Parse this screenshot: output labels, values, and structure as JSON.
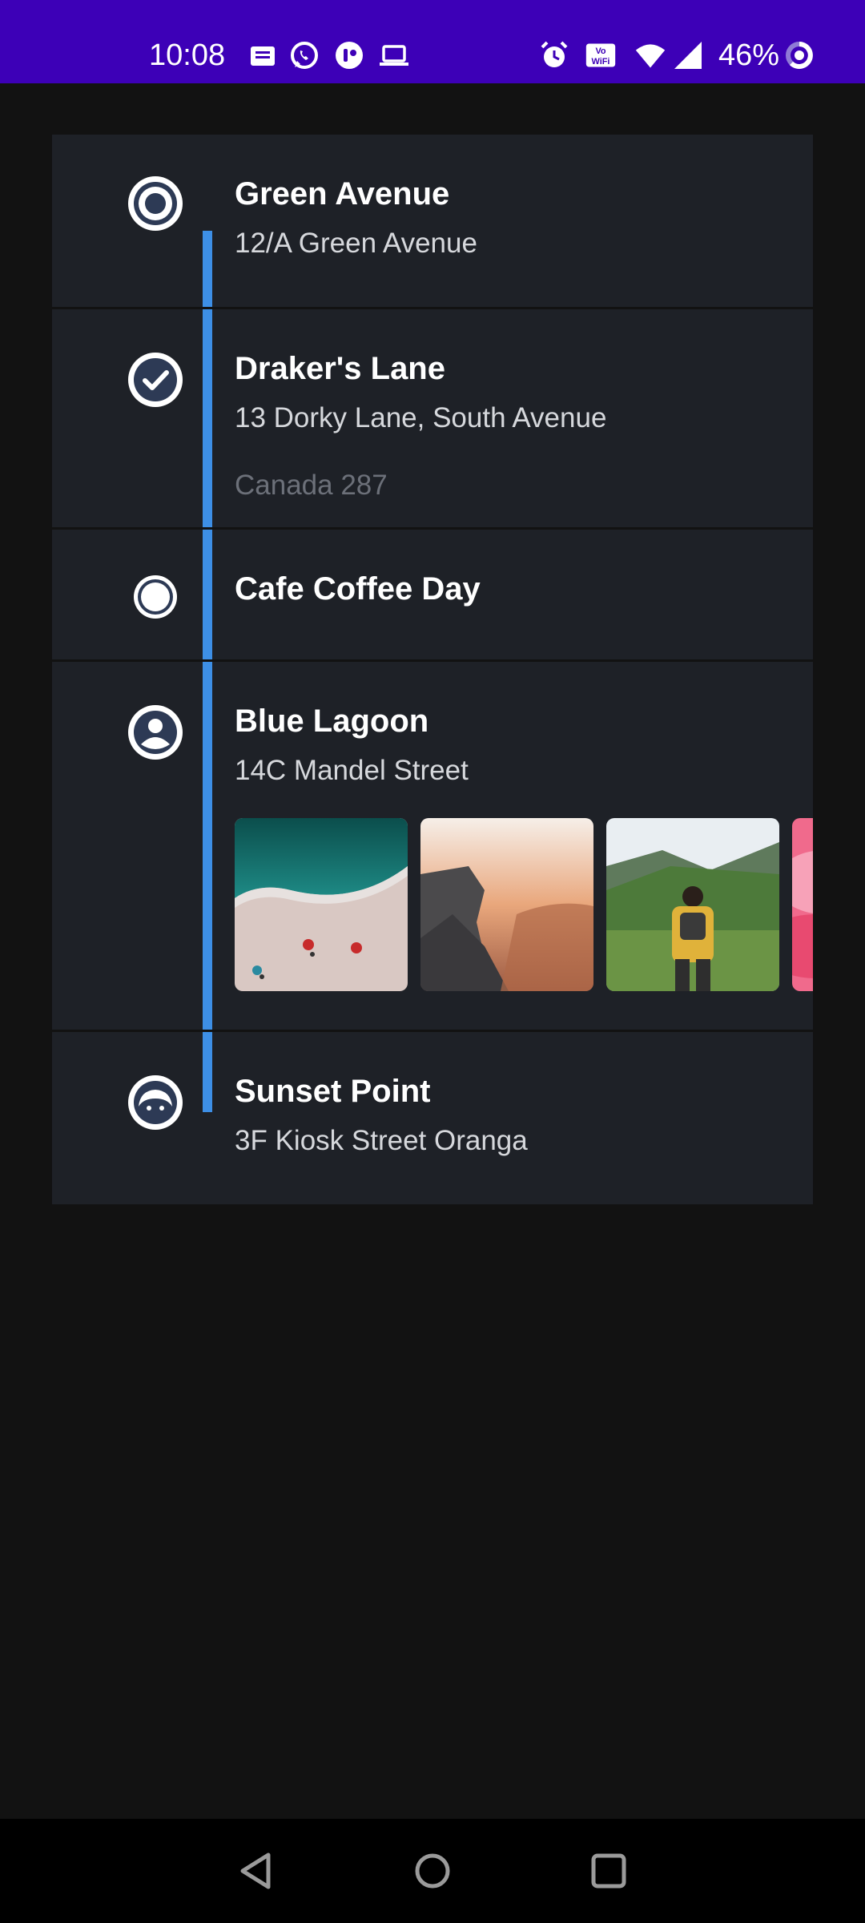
{
  "status_bar": {
    "time": "10:08",
    "battery_percent": "46%",
    "left_icons": [
      "message-icon",
      "whatsapp-icon",
      "app-icon",
      "laptop-icon"
    ],
    "right_icons": [
      "alarm-icon",
      "vowifi-icon",
      "wifi-icon",
      "signal-icon",
      "battery-ring-icon"
    ]
  },
  "timeline": {
    "accent_color": "#3d8fe6",
    "items": [
      {
        "title": "Green Avenue",
        "subtitle": "12/A Green Avenue",
        "marker_icon": "radio-target-icon"
      },
      {
        "title": "Draker's Lane",
        "subtitle": "13 Dorky Lane, South Avenue",
        "tertiary": "Canada 287",
        "marker_icon": "check-circle-icon"
      },
      {
        "title": "Cafe Coffee Day",
        "marker_icon": "dot-circle-icon"
      },
      {
        "title": "Blue Lagoon",
        "subtitle": "14C Mandel Street",
        "marker_icon": "account-circle-icon",
        "photos": [
          "beach-aerial-photo",
          "canyon-sunset-photo",
          "hiker-valley-photo",
          "pink-flower-photo"
        ]
      },
      {
        "title": "Sunset Point",
        "subtitle": "3F Kiosk Street Oranga",
        "marker_icon": "face-icon"
      }
    ]
  },
  "nav_bar": {
    "buttons": [
      "back-icon",
      "home-icon",
      "recents-icon"
    ]
  }
}
